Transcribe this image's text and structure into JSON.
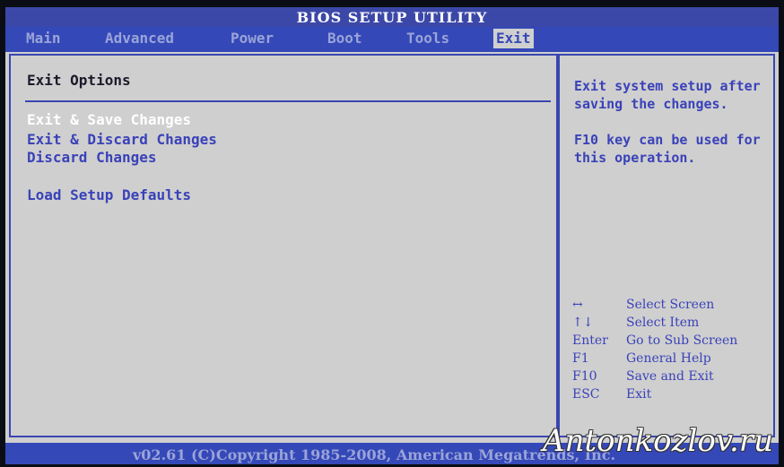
{
  "title": "BIOS SETUP UTILITY",
  "tabs": [
    {
      "label": "Main"
    },
    {
      "label": "Advanced"
    },
    {
      "label": "Power"
    },
    {
      "label": "Boot"
    },
    {
      "label": "Tools"
    },
    {
      "label": "Exit"
    }
  ],
  "exit_options": {
    "heading": "Exit Options",
    "items": [
      {
        "label": "Exit & Save Changes"
      },
      {
        "label": "Exit & Discard Changes"
      },
      {
        "label": "Discard Changes"
      },
      {
        "label": "Load Setup Defaults"
      }
    ]
  },
  "help": {
    "description": "Exit system setup after saving the changes.",
    "f10_note": "F10 key can be used for this operation."
  },
  "key_legend": [
    {
      "key": "↔",
      "action": "Select Screen"
    },
    {
      "key": "↑↓",
      "action": "Select Item"
    },
    {
      "key": "Enter",
      "action": "Go to Sub Screen"
    },
    {
      "key": "F1",
      "action": "General Help"
    },
    {
      "key": "F10",
      "action": "Save and Exit"
    },
    {
      "key": "ESC",
      "action": "Exit"
    }
  ],
  "footer": "v02.61 (C)Copyright 1985-2008, American Megatrends, Inc.",
  "watermark": "Antonkozlov.ru",
  "colors": {
    "bios_blue": "#3548b8",
    "panel_gray": "#cfcfcf",
    "text_blue": "#3a42b8",
    "selected_text": "#ffffff"
  }
}
